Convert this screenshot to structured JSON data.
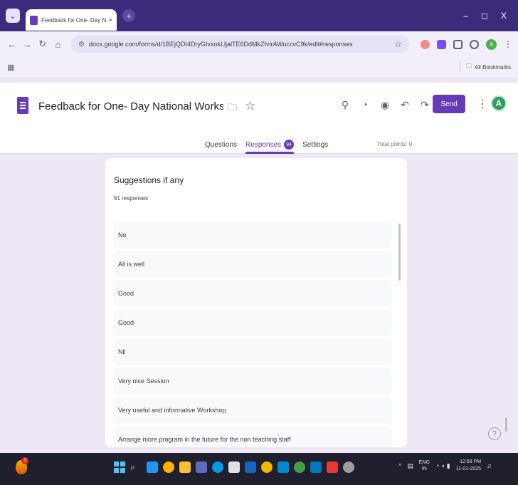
{
  "browser": {
    "tab_title": "Feedback for One- Day National",
    "tab_close": "×",
    "new_tab": "+",
    "window_controls": [
      "–",
      "◻",
      "X"
    ],
    "url": "docs.google.com/forms/d/1BEjQDI4DryGIvxokLljalTE6DdMkZfvirAWuccvC9k/edit#responses",
    "bookmarks_label": "All Bookmarks"
  },
  "form": {
    "title": "Feedback for  One- Day National Workshop on Strengthening",
    "send_label": "Send",
    "account_initial": "A",
    "tabs": [
      {
        "label": "Questions"
      },
      {
        "label": "Responses",
        "badge": "94"
      },
      {
        "label": "Settings"
      }
    ],
    "total_points": "Total points: 0"
  },
  "question": {
    "title": "Suggestions if any",
    "count": "61 responses",
    "answers": [
      "No",
      "All is well",
      "Good",
      "Good",
      "Nil",
      "Very nice Session",
      "Very useful and informative Workshop",
      "Arrange more program in the future for the non teaching staff"
    ]
  },
  "taskbar": {
    "weather_badge": "3",
    "lang_top": "ENG",
    "lang_bottom": "IN",
    "time": "12:58 PM",
    "date": "11-01-2025"
  },
  "colors": {
    "accent": "#673ab7",
    "page_background": "#ede7f6",
    "tabstrip": "#3c2a7a"
  }
}
